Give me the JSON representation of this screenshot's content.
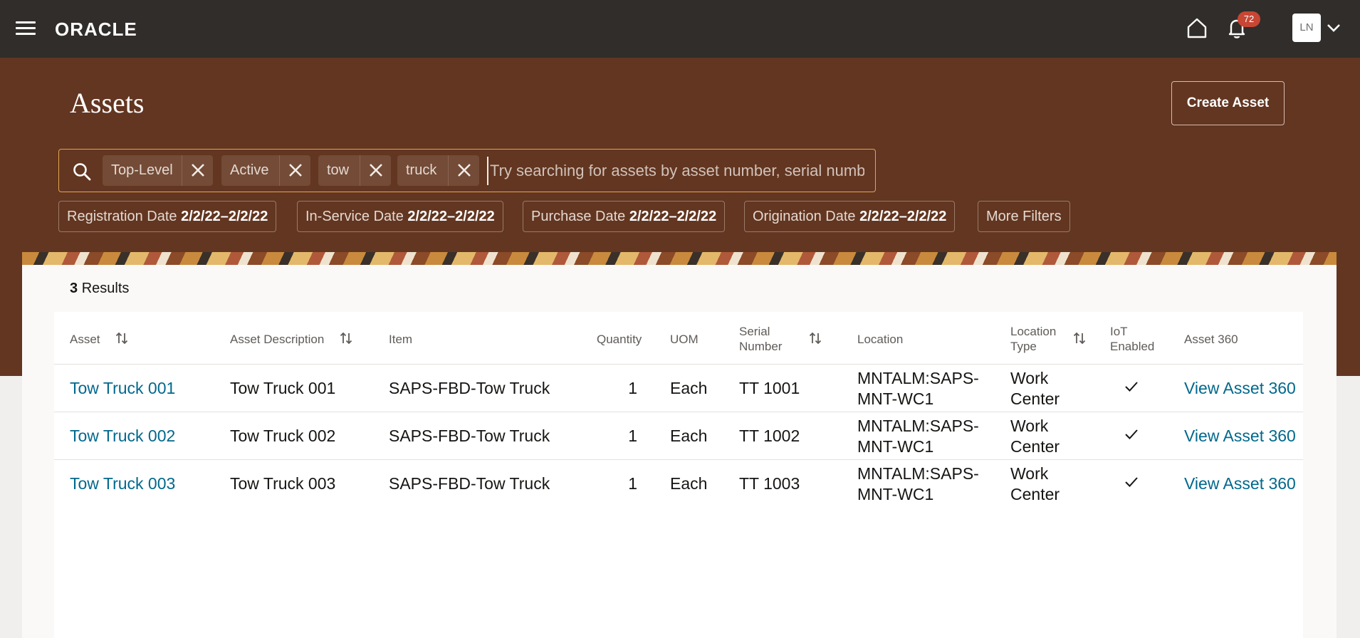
{
  "header": {
    "logo_text": "ORACLE",
    "notification_count": "72",
    "user_initials": "LN"
  },
  "page": {
    "title": "Assets",
    "create_button_label": "Create Asset"
  },
  "search": {
    "chips": [
      {
        "label": "Top-Level"
      },
      {
        "label": "Active"
      },
      {
        "label": "tow"
      },
      {
        "label": "truck"
      }
    ],
    "placeholder": "Try searching for assets by asset number, serial numb"
  },
  "filters": [
    {
      "label": "Registration Date",
      "value": "2/2/22–2/2/22"
    },
    {
      "label": "In-Service Date",
      "value": "2/2/22–2/2/22"
    },
    {
      "label": "Purchase Date",
      "value": "2/2/22–2/2/22"
    },
    {
      "label": "Origination Date",
      "value": "2/2/22–2/2/22"
    },
    {
      "label": "More Filters",
      "value": ""
    }
  ],
  "results": {
    "count": "3",
    "label": "Results"
  },
  "table": {
    "columns": [
      {
        "label": "Asset",
        "sortable": true
      },
      {
        "label": "Asset Description",
        "sortable": true
      },
      {
        "label": "Item",
        "sortable": false
      },
      {
        "label": "Quantity",
        "sortable": false
      },
      {
        "label": "UOM",
        "sortable": false
      },
      {
        "label": "Serial Number",
        "sortable": true
      },
      {
        "label": "Location",
        "sortable": false
      },
      {
        "label": "Location Type",
        "sortable": true
      },
      {
        "label": "IoT Enabled",
        "sortable": false
      },
      {
        "label": "Asset 360",
        "sortable": false
      }
    ],
    "rows": [
      {
        "asset": "Tow Truck 001",
        "description": "Tow Truck 001",
        "item": "SAPS-FBD-Tow Truck",
        "quantity": "1",
        "uom": "Each",
        "serial": "TT 1001",
        "location": "MNTALM:SAPS-MNT-WC1",
        "location_type": "Work Center",
        "iot_enabled": true,
        "asset360": "View Asset 360"
      },
      {
        "asset": "Tow Truck 002",
        "description": "Tow Truck 002",
        "item": "SAPS-FBD-Tow Truck",
        "quantity": "1",
        "uom": "Each",
        "serial": "TT 1002",
        "location": "MNTALM:SAPS-MNT-WC1",
        "location_type": "Work Center",
        "iot_enabled": true,
        "asset360": "View Asset 360"
      },
      {
        "asset": "Tow Truck 003",
        "description": "Tow Truck 003",
        "item": "SAPS-FBD-Tow Truck",
        "quantity": "1",
        "uom": "Each",
        "serial": "TT 1003",
        "location": "MNTALM:SAPS-MNT-WC1",
        "location_type": "Work Center",
        "iot_enabled": true,
        "asset360": "View Asset 360"
      }
    ]
  },
  "colors": {
    "topbar": "#312d2a",
    "band": "#623621",
    "link": "#00688c",
    "badge": "#c74634",
    "search_border": "#e2a54f"
  }
}
